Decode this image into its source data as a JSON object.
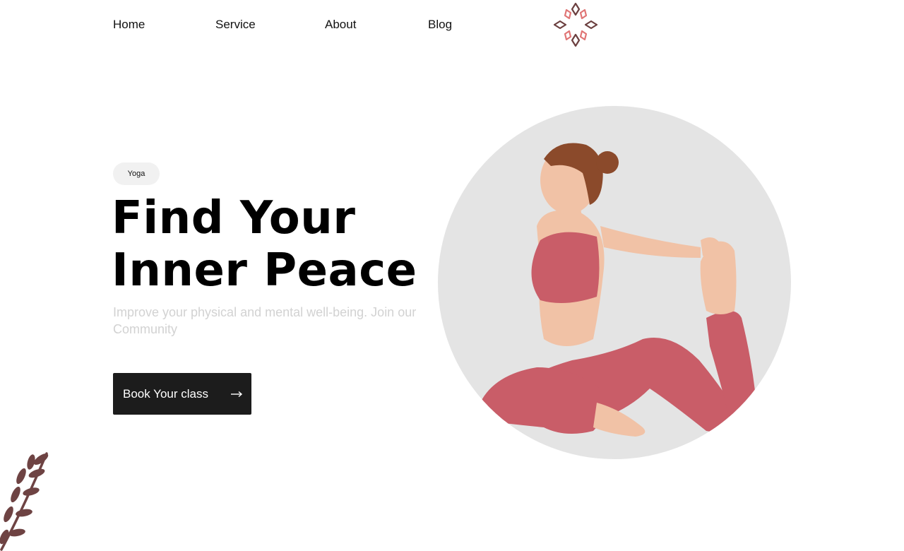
{
  "nav": {
    "items": [
      {
        "label": "Home"
      },
      {
        "label": "Service"
      },
      {
        "label": "About"
      },
      {
        "label": "Blog"
      }
    ]
  },
  "logo": {
    "icon": "lotus-flower-logo",
    "colors": [
      "#e07575",
      "#6b3f3f"
    ]
  },
  "hero": {
    "tag": "Yoga",
    "headline_line1": "Find Your",
    "headline_line2": "Inner Peace",
    "subtitle": "Improve your physical and mental well-being. Join our Community",
    "cta_label": "Book Your class",
    "cta_icon": "arrow-right-icon",
    "image": {
      "icon": "yoga-woman-photo",
      "outfit_color": "#c95d68",
      "backdrop_color": "#e4e4e4"
    }
  },
  "decoration": {
    "icon": "leaf-sprig-icon",
    "color": "#6e4343"
  }
}
